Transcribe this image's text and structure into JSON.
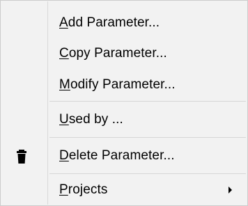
{
  "menu": {
    "items": [
      {
        "mnemonic": "A",
        "rest": "dd Parameter..."
      },
      {
        "mnemonic": "C",
        "rest": "opy Parameter..."
      },
      {
        "mnemonic": "M",
        "rest": "odify Parameter..."
      },
      {
        "mnemonic": "U",
        "rest": "sed by ..."
      },
      {
        "mnemonic": "D",
        "rest": "elete Parameter...",
        "icon": "trash-icon"
      },
      {
        "mnemonic": "P",
        "rest": "rojects",
        "submenu_icon": "chevron-right-icon"
      }
    ]
  }
}
